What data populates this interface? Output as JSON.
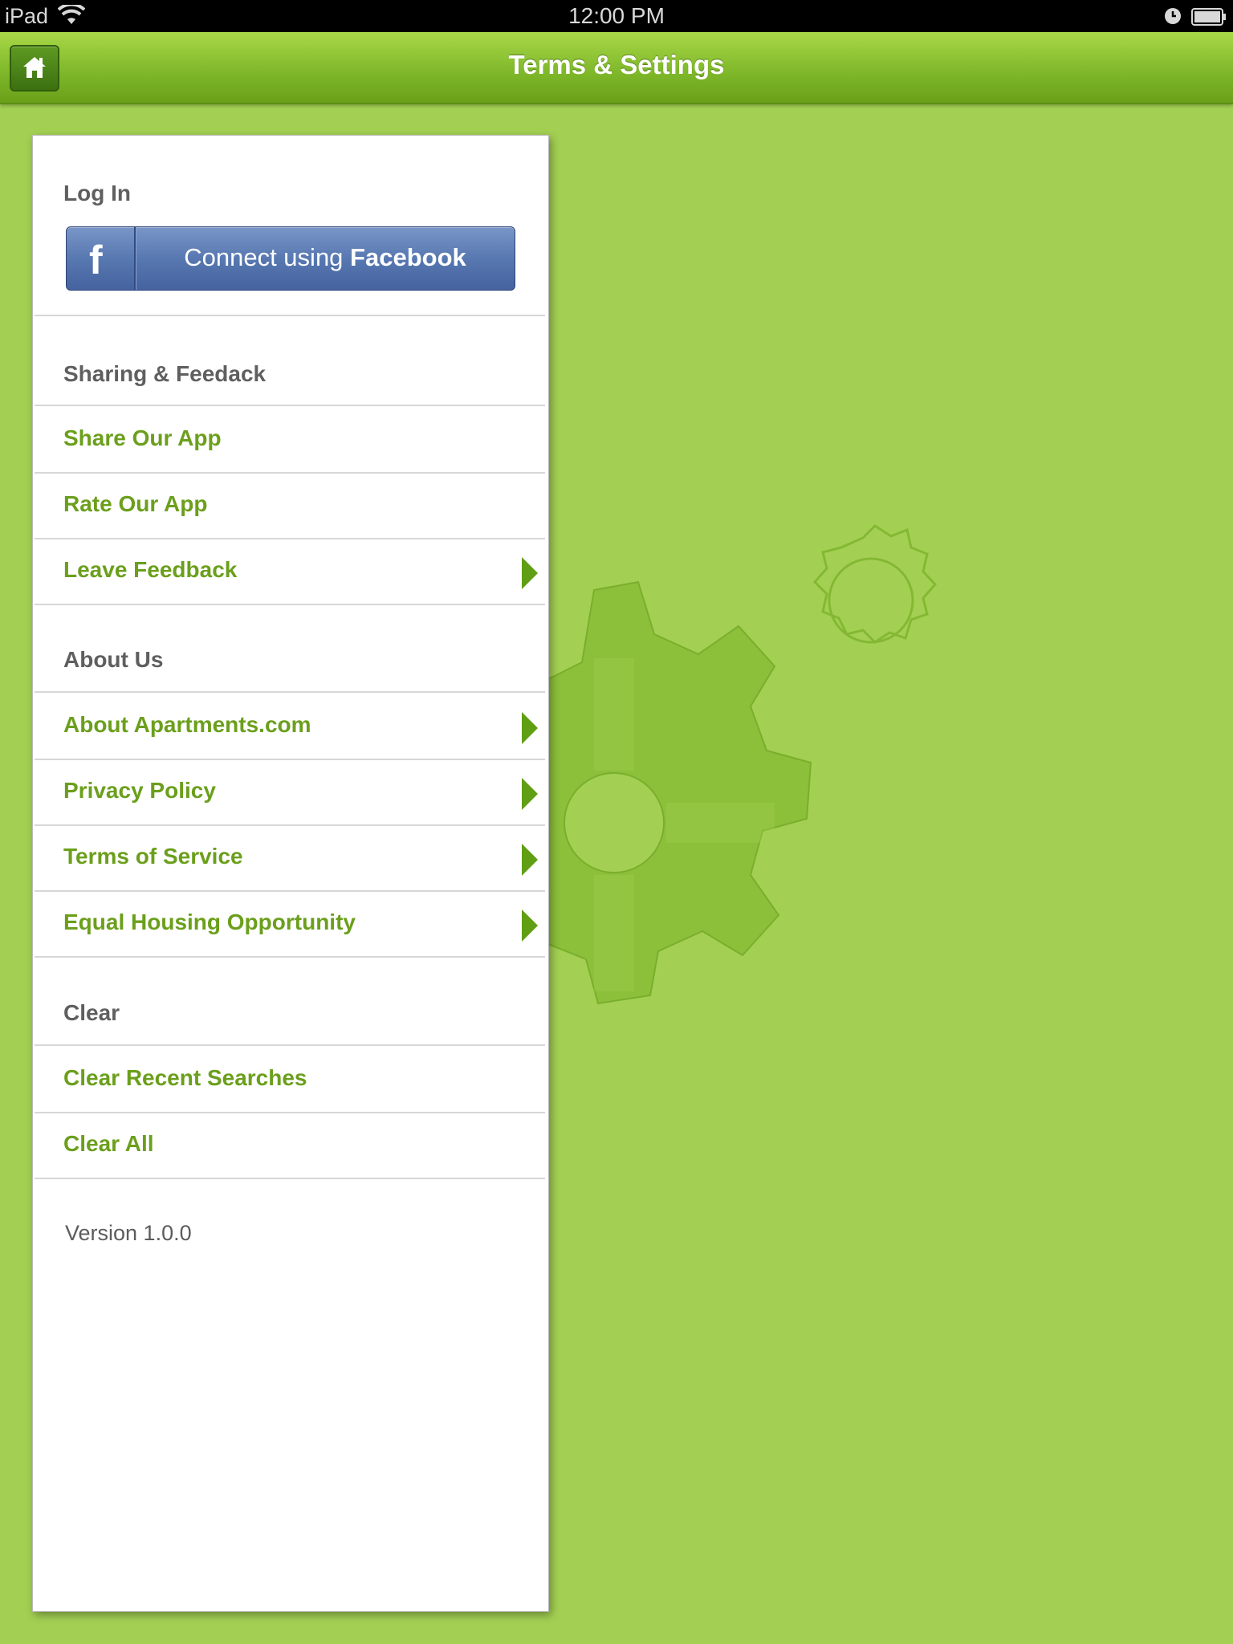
{
  "status_bar": {
    "device": "iPad",
    "time": "12:00 PM"
  },
  "nav": {
    "title": "Terms & Settings",
    "home_icon": "home-icon"
  },
  "login": {
    "section_title": "Log In",
    "facebook_button": {
      "prefix": "Connect using ",
      "brand": "Facebook",
      "icon": "facebook-icon"
    }
  },
  "sharing": {
    "section_title": "Sharing & Feedack",
    "items": [
      {
        "label": "Share Our App"
      },
      {
        "label": "Rate Our App"
      },
      {
        "label": "Leave Feedback"
      }
    ]
  },
  "about": {
    "section_title": "About Us",
    "items": [
      {
        "label": "About Apartments.com"
      },
      {
        "label": "Privacy Policy"
      },
      {
        "label": "Terms of Service"
      },
      {
        "label": "Equal Housing Opportunity"
      }
    ]
  },
  "clear": {
    "section_title": "Clear",
    "items": [
      {
        "label": "Clear Recent Searches"
      },
      {
        "label": "Clear All"
      }
    ]
  },
  "version": "Version 1.0.0",
  "colors": {
    "background": "#a3d053",
    "nav_green": "#80b92b",
    "link_green": "#6b9f1c",
    "facebook_blue": "#5878b1"
  }
}
